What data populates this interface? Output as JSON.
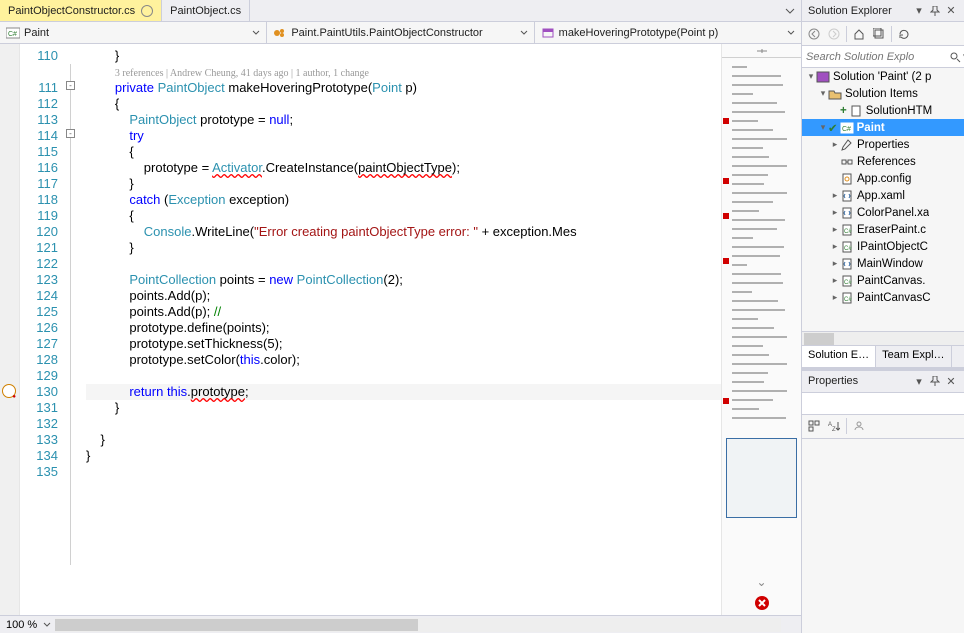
{
  "tabs": {
    "files": [
      {
        "name": "PaintObjectConstructor.cs",
        "active": true,
        "pinned": true
      },
      {
        "name": "PaintObject.cs",
        "active": false,
        "pinned": false
      }
    ]
  },
  "navbar": {
    "scope": "Paint",
    "type": "Paint.PaintUtils.PaintObjectConstructor",
    "member": "makeHoveringPrototype(Point p)"
  },
  "gutter": {
    "start": 110,
    "end": 135
  },
  "codelens": "3 references | Andrew Cheung, 41 days ago | 1 author, 1 change",
  "code_lines": [
    {
      "n": 110,
      "html": "        }"
    },
    {
      "n": "",
      "html": "",
      "lens": true
    },
    {
      "n": 111,
      "html": "        <span class=\"kw\">private</span> <span class=\"type\">PaintObject</span> makeHoveringPrototype(<span class=\"type\">Point</span> p)"
    },
    {
      "n": 112,
      "html": "        {"
    },
    {
      "n": 113,
      "html": "            <span class=\"type\">PaintObject</span> prototype = <span class=\"kw\">null</span>;"
    },
    {
      "n": 114,
      "html": "            <span class=\"kw\">try</span>"
    },
    {
      "n": 115,
      "html": "            {"
    },
    {
      "n": 116,
      "html": "                prototype = <span class=\"type err\">Activator</span>.CreateInstance(<span class=\"err\">paintObjectType</span>);"
    },
    {
      "n": 117,
      "html": "            }"
    },
    {
      "n": 118,
      "html": "            <span class=\"kw\">catch</span> (<span class=\"type\">Exception</span> exception)"
    },
    {
      "n": 119,
      "html": "            {"
    },
    {
      "n": 120,
      "html": "                <span class=\"type\">Console</span>.WriteLine(<span class=\"str\">\"Error creating paintObjectType error: \"</span> + exception.Mes"
    },
    {
      "n": 121,
      "html": "            }"
    },
    {
      "n": 122,
      "html": ""
    },
    {
      "n": 123,
      "html": "            <span class=\"type\">PointCollection</span> points = <span class=\"kw\">new</span> <span class=\"type\">PointCollection</span>(2);"
    },
    {
      "n": 124,
      "html": "            points.Add(p);"
    },
    {
      "n": 125,
      "html": "            points.Add(p); <span class=\"cmt\">//</span>"
    },
    {
      "n": 126,
      "html": "            prototype.define(points);"
    },
    {
      "n": 127,
      "html": "            prototype.setThickness(5);"
    },
    {
      "n": 128,
      "html": "            prototype.setColor(<span class=\"kw\">this</span>.color);"
    },
    {
      "n": 129,
      "html": ""
    },
    {
      "n": 130,
      "html": "            <span class=\"kw\">return</span> <span class=\"kw\">this</span>.<span class=\"err\">prototype</span>;",
      "hl": true,
      "err": true
    },
    {
      "n": 131,
      "html": "        }"
    },
    {
      "n": 132,
      "html": ""
    },
    {
      "n": 133,
      "html": "    }"
    },
    {
      "n": 134,
      "html": "}"
    },
    {
      "n": 135,
      "html": ""
    }
  ],
  "zoom": "100 %",
  "solution_explorer": {
    "title": "Solution Explorer",
    "search_placeholder": "Search Solution Explo",
    "tree": [
      {
        "depth": 0,
        "exp": "▾",
        "icon": "sln",
        "label": "Solution 'Paint' (2 p"
      },
      {
        "depth": 1,
        "exp": "▾",
        "icon": "fld",
        "label": "Solution Items"
      },
      {
        "depth": 2,
        "exp": " ",
        "icon": "doc",
        "label": "SolutionHTM",
        "add": true
      },
      {
        "depth": 1,
        "exp": "▾",
        "icon": "csproj",
        "label": "Paint",
        "sel": true,
        "bold": true,
        "chk": true
      },
      {
        "depth": 2,
        "exp": "▸",
        "icon": "prop",
        "label": "Properties"
      },
      {
        "depth": 2,
        "exp": " ",
        "icon": "ref",
        "label": "References"
      },
      {
        "depth": 2,
        "exp": " ",
        "icon": "cfg",
        "label": "App.config"
      },
      {
        "depth": 2,
        "exp": "▸",
        "icon": "xaml",
        "label": "App.xaml"
      },
      {
        "depth": 2,
        "exp": "▸",
        "icon": "xaml",
        "label": "ColorPanel.xa"
      },
      {
        "depth": 2,
        "exp": "▸",
        "icon": "cs",
        "label": "EraserPaint.c"
      },
      {
        "depth": 2,
        "exp": "▸",
        "icon": "cs",
        "label": "IPaintObjectC"
      },
      {
        "depth": 2,
        "exp": "▸",
        "icon": "xaml",
        "label": "MainWindow"
      },
      {
        "depth": 2,
        "exp": "▸",
        "icon": "cs",
        "label": "PaintCanvas."
      },
      {
        "depth": 2,
        "exp": "▸",
        "icon": "cs",
        "label": "PaintCanvasC"
      }
    ],
    "bottom_tabs": [
      {
        "label": "Solution E…",
        "active": true
      },
      {
        "label": "Team Expl…",
        "active": false
      }
    ]
  },
  "properties": {
    "title": "Properties"
  }
}
